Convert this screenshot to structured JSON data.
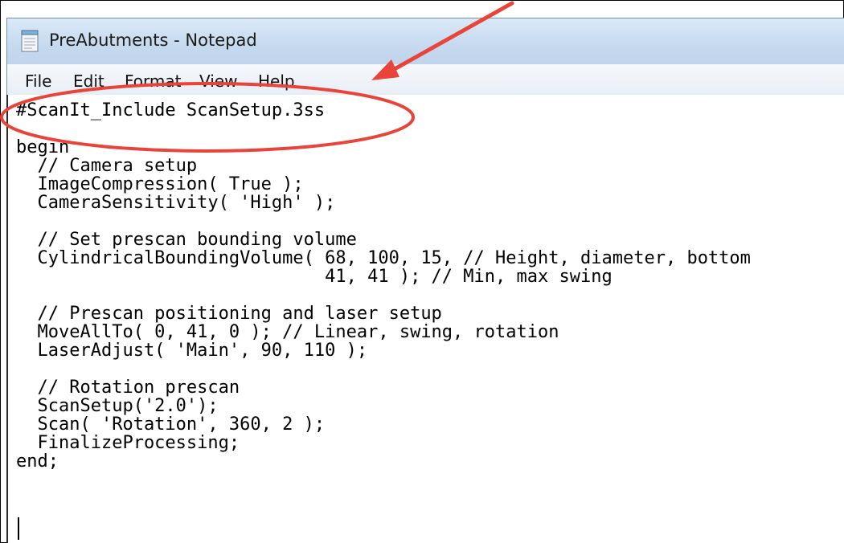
{
  "window": {
    "title": "PreAbutments - Notepad"
  },
  "menu": {
    "items": [
      "File",
      "Edit",
      "Format",
      "View",
      "Help"
    ]
  },
  "editor": {
    "lines": [
      "#ScanIt_Include ScanSetup.3ss",
      "",
      "begin",
      "  // Camera setup",
      "  ImageCompression( True );",
      "  CameraSensitivity( 'High' );",
      "",
      "  // Set prescan bounding volume",
      "  CylindricalBoundingVolume( 68, 100, 15, // Height, diameter, bottom",
      "                             41, 41 ); // Min, max swing",
      "",
      "  // Prescan positioning and laser setup",
      "  MoveAllTo( 0, 41, 0 ); // Linear, swing, rotation",
      "  LaserAdjust( 'Main', 90, 110 );",
      "",
      "  // Rotation prescan",
      "  ScanSetup('2.0');",
      "  Scan( 'Rotation', 360, 2 );",
      "  FinalizeProcessing;",
      "end;"
    ]
  },
  "annotation": {
    "color": "#e8443a"
  }
}
